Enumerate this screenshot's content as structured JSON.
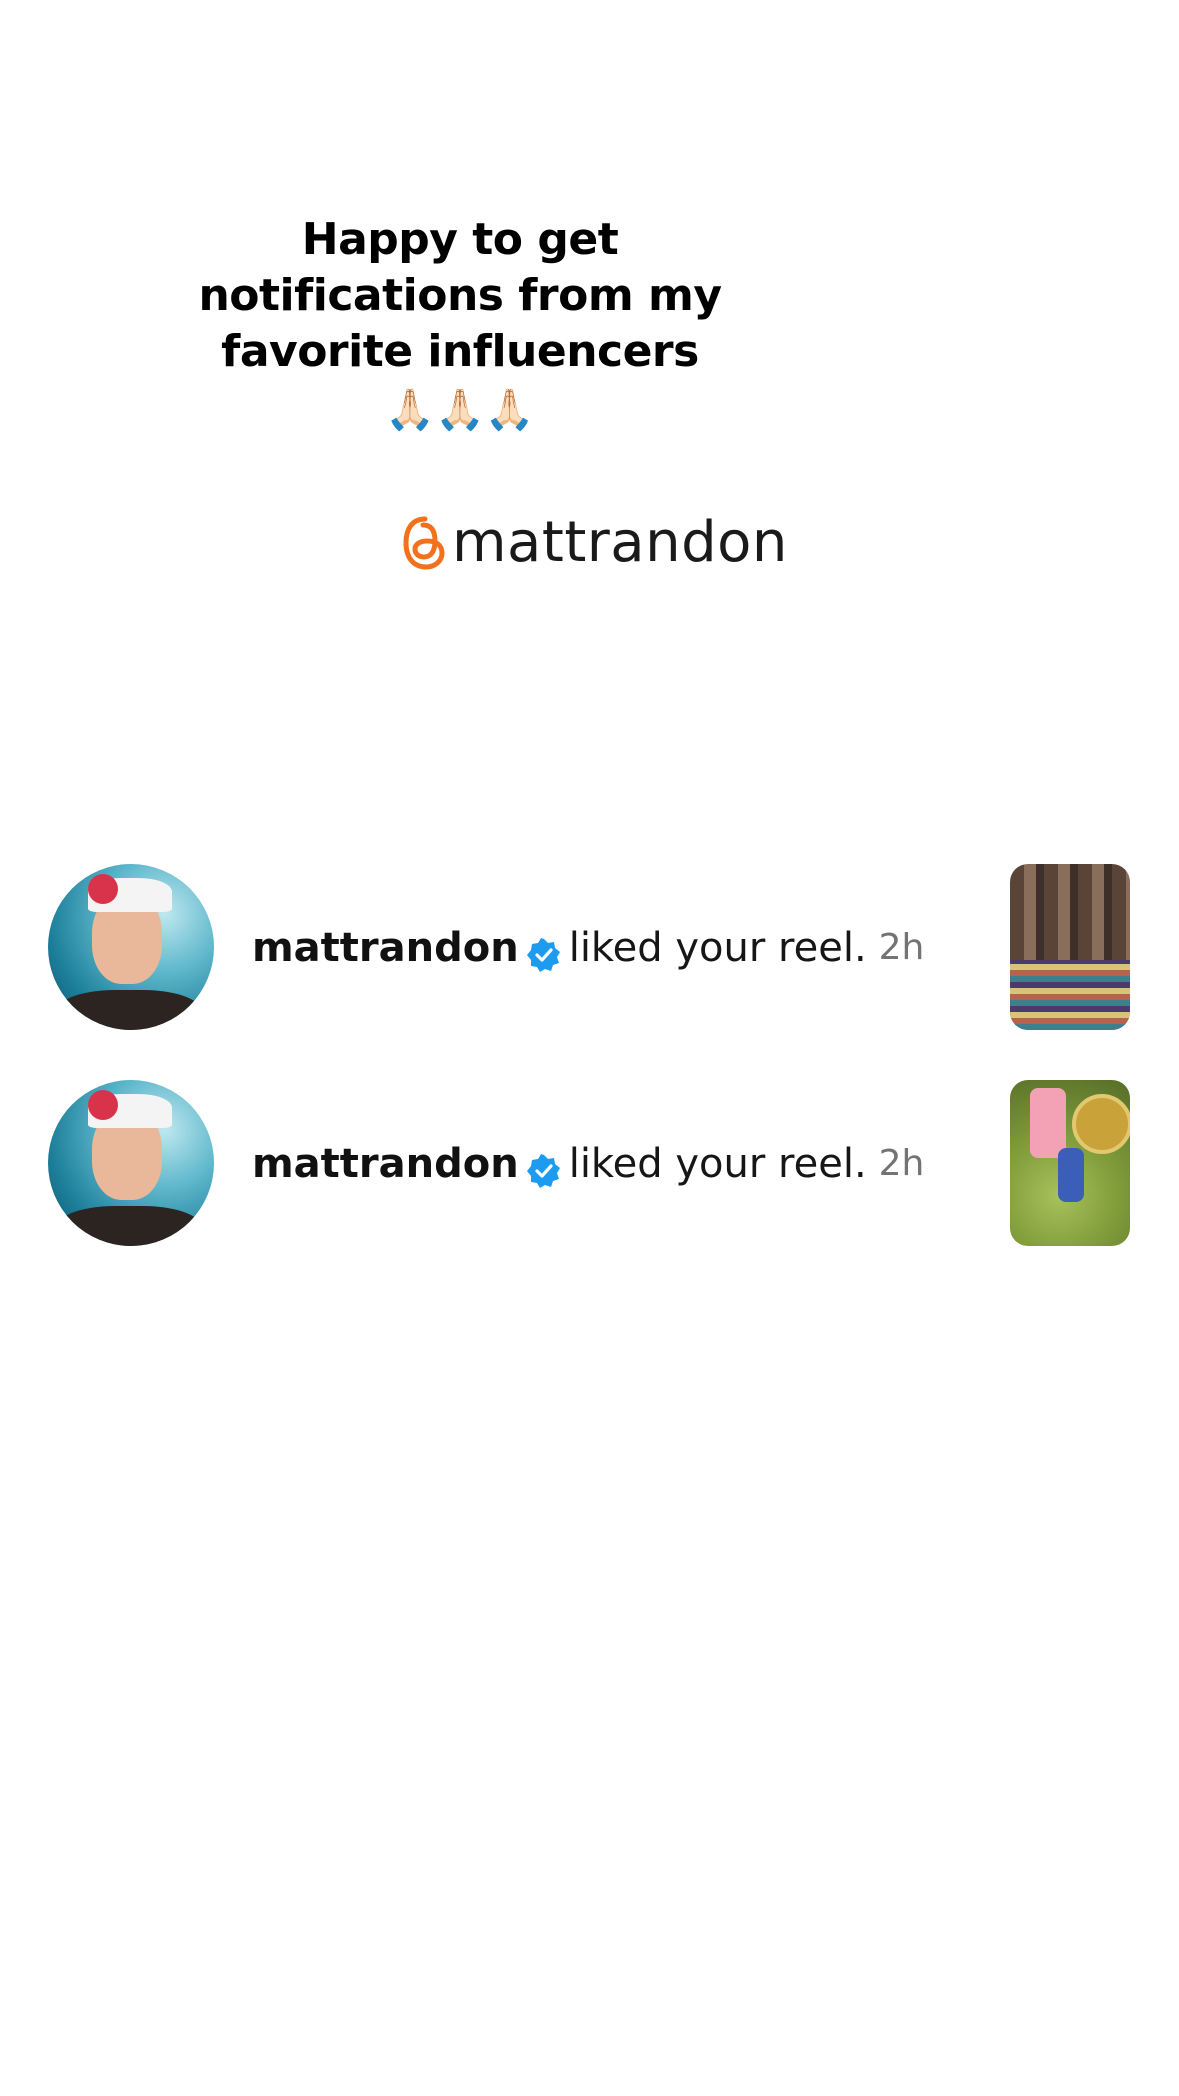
{
  "caption": {
    "line1": "Happy to get",
    "line2": "notifications from my",
    "line3": "favorite influencers",
    "emoji": "🙏🏻🙏🏻🙏🏻"
  },
  "handle": {
    "icon": "threads-icon",
    "accent_color": "#f2711c",
    "text": "mattrandon"
  },
  "notifications": [
    {
      "username": "mattrandon",
      "verified": true,
      "action": "liked your reel.",
      "time": "2h",
      "avatar": "profile-avatar",
      "thumbnail": "reel-thumbnail-1"
    },
    {
      "username": "mattrandon",
      "verified": true,
      "action": "liked your reel.",
      "time": "2h",
      "avatar": "profile-avatar",
      "thumbnail": "reel-thumbnail-2"
    }
  ],
  "colors": {
    "verified_badge": "#1d9bf0",
    "time_text": "#737373"
  }
}
